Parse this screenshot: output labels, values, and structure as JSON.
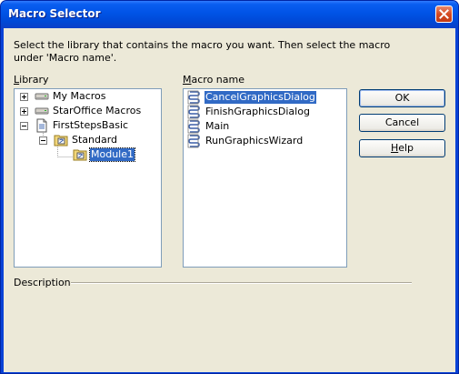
{
  "window": {
    "title": "Macro Selector"
  },
  "instruction": "Select the library that contains the macro you want. Then select the macro under 'Macro name'.",
  "library": {
    "label": "Library",
    "items": [
      {
        "label": "My Macros"
      },
      {
        "label": "StarOffice Macros"
      },
      {
        "label": "FirstStepsBasic"
      },
      {
        "label": "Standard"
      },
      {
        "label": "Module1"
      }
    ]
  },
  "macros": {
    "label": "Macro name",
    "items": [
      {
        "label": "CancelGraphicsDialog"
      },
      {
        "label": "FinishGraphicsDialog"
      },
      {
        "label": "Main"
      },
      {
        "label": "RunGraphicsWizard"
      }
    ]
  },
  "buttons": {
    "ok": "OK",
    "cancel": "Cancel",
    "help": "Help"
  },
  "description": {
    "label": "Description"
  }
}
